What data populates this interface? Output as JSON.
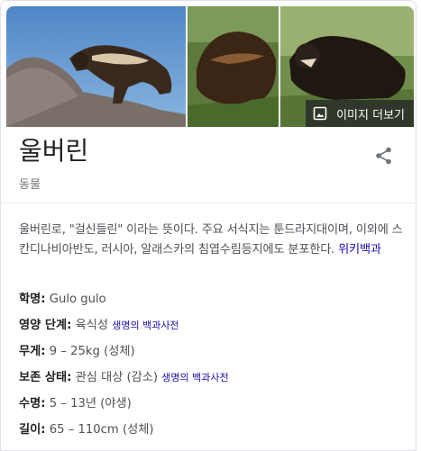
{
  "more_images_label": "이미지 더보기",
  "title": "울버린",
  "subtitle": "동물",
  "description": {
    "text": "울버린로, \"걸신들린\" 이라는 뜻이다. 주요 서식지는 툰드라지대이며, 이외에 스칸디나비아반도, 러시아, 알래스카의 침엽수림등지에도 분포한다.",
    "source_link": "위키백과"
  },
  "facts": [
    {
      "label": "학명",
      "value": "Gulo gulo",
      "source": ""
    },
    {
      "label": "영양 단계",
      "value": "육식성",
      "source": "생명의 백과사전"
    },
    {
      "label": "무게",
      "value": "9 – 25kg (성체)",
      "source": ""
    },
    {
      "label": "보존 상태",
      "value": "관심 대상 (감소)",
      "source": "생명의 백과사전"
    },
    {
      "label": "수명",
      "value": "5 – 13년 (야생)",
      "source": ""
    },
    {
      "label": "길이",
      "value": "65 – 110cm (성체)",
      "source": ""
    }
  ]
}
